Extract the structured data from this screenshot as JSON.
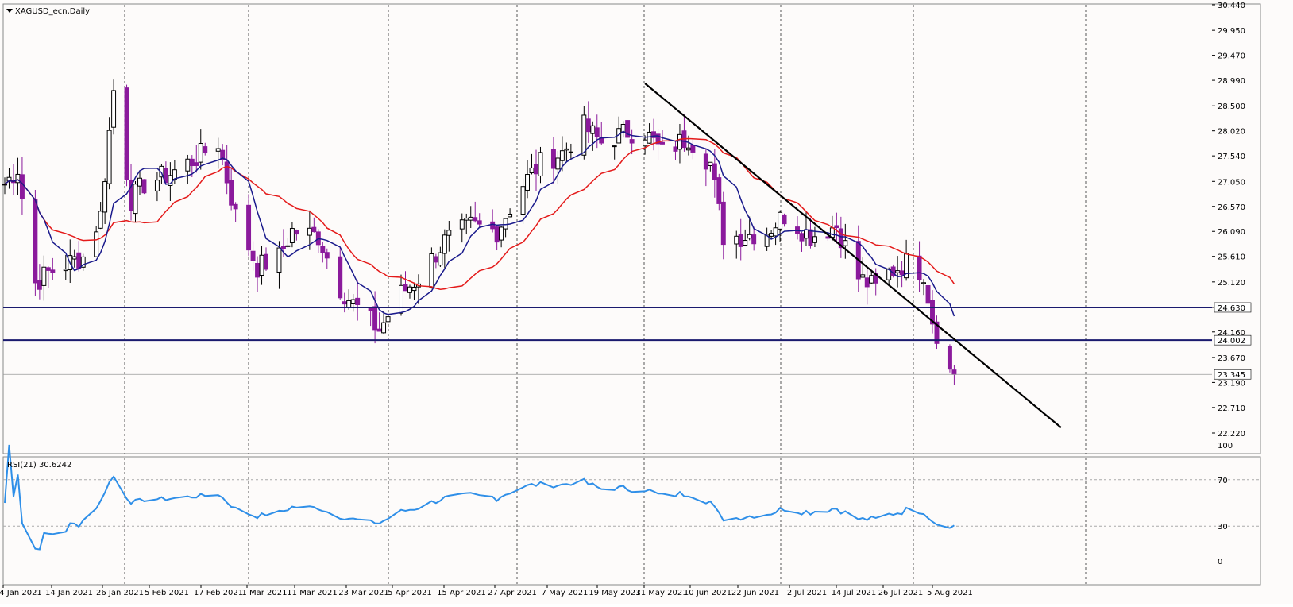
{
  "window": {
    "title": "XAGUSD_ecn,Daily"
  },
  "rsi_panel": {
    "label": "RSI(21) 30.6242"
  },
  "colors": {
    "background": "#fdfbfa",
    "bull_candle": "#000000",
    "bear_candle": "#8b1a9c",
    "ma_fast": "#1a1a8c",
    "ma_slow": "#e41a1a",
    "rsi_line": "#2f8fe8",
    "support_line": "#1a1a6e",
    "trend_line": "#000000",
    "grid": "#555555"
  },
  "chart_data": [
    {
      "type": "candlestick",
      "title": "XAGUSD_ecn,Daily",
      "ylim": [
        22.22,
        30.44
      ],
      "y_ticks": [
        "30.440",
        "29.950",
        "29.470",
        "28.990",
        "28.500",
        "28.020",
        "27.540",
        "27.050",
        "26.570",
        "26.090",
        "25.610",
        "25.120",
        "24.630",
        "24.160",
        "23.670",
        "23.190",
        "22.710",
        "22.220"
      ],
      "x_labels": [
        "4 Jan 2021",
        "14 Jan 2021",
        "26 Jan 2021",
        "5 Feb 2021",
        "17 Feb 2021",
        "1 Mar 2021",
        "11 Mar 2021",
        "23 Mar 2021",
        "5 Apr 2021",
        "15 Apr 2021",
        "27 Apr 2021",
        "7 May 2021",
        "19 May 2021",
        "31 May 2021",
        "10 Jun 2021",
        "22 Jun 2021",
        "2 Jul 2021",
        "14 Jul 2021",
        "26 Jul 2021",
        "5 Aug 2021"
      ],
      "horizontal_lines": [
        {
          "value": 24.63,
          "label": "24.630"
        },
        {
          "value": 24.002,
          "label": "24.002"
        }
      ],
      "current_price": {
        "value": 23.345,
        "label": "23.345"
      },
      "trendline": {
        "from": {
          "date": "31 May 2021",
          "value": 28.93
        },
        "to": {
          "date": "9 Aug 2021",
          "value": 24.09
        }
      },
      "price_path": [
        {
          "date": "4 Jan 2021",
          "close": 27.0
        },
        {
          "date": "7 Jan 2021",
          "close": 27.3
        },
        {
          "date": "11 Jan 2021",
          "close": 25.1
        },
        {
          "date": "14 Jan 2021",
          "close": 25.3
        },
        {
          "date": "19 Jan 2021",
          "close": 25.5
        },
        {
          "date": "22 Jan 2021",
          "close": 25.6
        },
        {
          "date": "26 Jan 2021",
          "close": 26.4
        },
        {
          "date": "29 Jan 2021",
          "close": 28.8
        },
        {
          "date": "2 Feb 2021",
          "close": 26.7
        },
        {
          "date": "5 Feb 2021",
          "close": 27.0
        },
        {
          "date": "11 Feb 2021",
          "close": 27.2
        },
        {
          "date": "17 Feb 2021",
          "close": 27.5
        },
        {
          "date": "22 Feb 2021",
          "close": 27.8
        },
        {
          "date": "26 Feb 2021",
          "close": 26.4
        },
        {
          "date": "3 Mar 2021",
          "close": 25.4
        },
        {
          "date": "8 Mar 2021",
          "close": 25.6
        },
        {
          "date": "11 Mar 2021",
          "close": 26.1
        },
        {
          "date": "17 Mar 2021",
          "close": 26.0
        },
        {
          "date": "22 Mar 2021",
          "close": 25.0
        },
        {
          "date": "25 Mar 2021",
          "close": 24.7
        },
        {
          "date": "31 Mar 2021",
          "close": 24.2
        },
        {
          "date": "5 Apr 2021",
          "close": 24.9
        },
        {
          "date": "9 Apr 2021",
          "close": 25.2
        },
        {
          "date": "15 Apr 2021",
          "close": 25.9
        },
        {
          "date": "21 Apr 2021",
          "close": 26.2
        },
        {
          "date": "27 Apr 2021",
          "close": 26.1
        },
        {
          "date": "3 May 2021",
          "close": 27.0
        },
        {
          "date": "7 May 2021",
          "close": 27.4
        },
        {
          "date": "12 May 2021",
          "close": 27.6
        },
        {
          "date": "17 May 2021",
          "close": 28.1
        },
        {
          "date": "21 May 2021",
          "close": 27.8
        },
        {
          "date": "27 May 2021",
          "close": 28.0
        },
        {
          "date": "31 May 2021",
          "close": 28.0
        },
        {
          "date": "4 Jun 2021",
          "close": 27.6
        },
        {
          "date": "10 Jun 2021",
          "close": 27.9
        },
        {
          "date": "15 Jun 2021",
          "close": 27.4
        },
        {
          "date": "18 Jun 2021",
          "close": 26.0
        },
        {
          "date": "22 Jun 2021",
          "close": 26.0
        },
        {
          "date": "28 Jun 2021",
          "close": 26.1
        },
        {
          "date": "2 Jul 2021",
          "close": 26.4
        },
        {
          "date": "8 Jul 2021",
          "close": 26.0
        },
        {
          "date": "14 Jul 2021",
          "close": 26.2
        },
        {
          "date": "19 Jul 2021",
          "close": 25.2
        },
        {
          "date": "23 Jul 2021",
          "close": 25.0
        },
        {
          "date": "26 Jul 2021",
          "close": 25.3
        },
        {
          "date": "30 Jul 2021",
          "close": 25.5
        },
        {
          "date": "3 Aug 2021",
          "close": 25.3
        },
        {
          "date": "5 Aug 2021",
          "close": 24.4
        },
        {
          "date": "9 Aug 2021",
          "close": 23.4
        },
        {
          "date": "10 Aug 2021",
          "close": 23.345
        }
      ]
    },
    {
      "type": "line",
      "title": "RSI(21) 30.6242",
      "ylim": [
        0,
        100
      ],
      "y_ticks": [
        "100",
        "70",
        "30",
        "0"
      ],
      "levels": [
        70,
        30
      ],
      "last_value": 30.6242
    }
  ]
}
